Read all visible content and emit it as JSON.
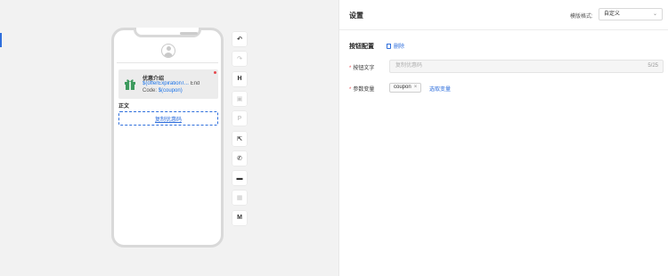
{
  "canvas": {
    "card": {
      "title": "优惠介绍",
      "line1_var": "$(offerExpirationT...",
      "line1_text": "End",
      "line2_text": "Code:",
      "line2_var": "$(coupon)"
    },
    "body_label": "正文",
    "copy_button": "复制优惠码",
    "tools": [
      {
        "icon": "undo-icon",
        "glyph": "↶",
        "enabled": true
      },
      {
        "icon": "redo-icon",
        "glyph": "↷",
        "enabled": false
      },
      {
        "icon": "heading-icon",
        "glyph": "H",
        "enabled": true
      },
      {
        "icon": "image-icon",
        "glyph": "▣",
        "enabled": false
      },
      {
        "icon": "paragraph-icon",
        "glyph": "P",
        "enabled": false
      },
      {
        "icon": "external-link-icon",
        "glyph": "⇱",
        "enabled": true
      },
      {
        "icon": "phone-icon",
        "glyph": "✆",
        "enabled": true
      },
      {
        "icon": "message-icon",
        "glyph": "▬",
        "enabled": true
      },
      {
        "icon": "grid-icon",
        "glyph": "▦",
        "enabled": false
      },
      {
        "icon": "menu-icon",
        "glyph": "M",
        "enabled": true
      }
    ]
  },
  "panel": {
    "title": "设置",
    "template_label": "模版格式:",
    "template_value": "自定义",
    "section_title": "按钮配置",
    "delete_label": "删除",
    "button_text_label": "按钮文字",
    "button_text_placeholder": "复制优惠码",
    "button_text_counter": "5/25",
    "param_label": "参数变量",
    "param_tag": "coupon",
    "select_var_label": "选取变量"
  },
  "colors": {
    "accent": "#2f6fdc",
    "required": "#e5484d",
    "gift": "#3e9a5e"
  }
}
